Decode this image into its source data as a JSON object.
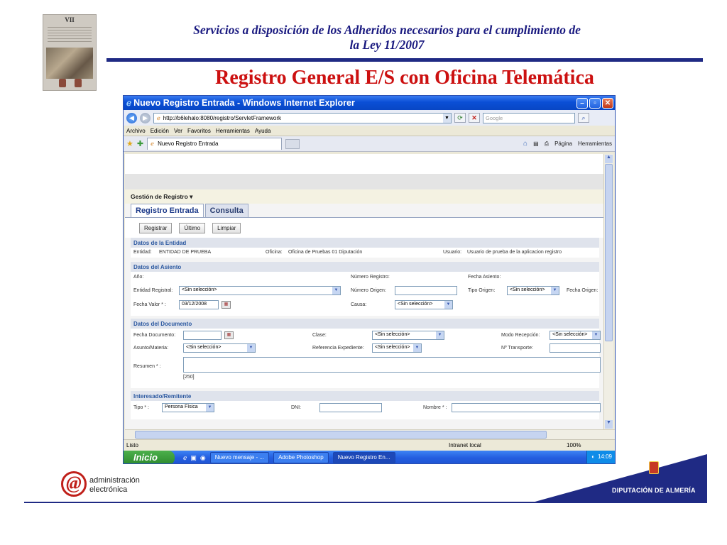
{
  "slide": {
    "header_line1": "Servicios a disposición de los Adheridos necesarios para el cumplimiento de",
    "header_line2": "la Ley 11/2007",
    "title": "Registro General E/S con Oficina Telemática",
    "thumbnail_title": "VII"
  },
  "browser": {
    "window_title": "Nuevo Registro Entrada - Windows Internet Explorer",
    "url": "http://b6lehalo:8080/registro/ServletFramework",
    "search_placeholder": "Google",
    "menu": [
      "Archivo",
      "Edición",
      "Ver",
      "Favoritos",
      "Herramientas",
      "Ayuda"
    ],
    "tab_label": "Nuevo Registro Entrada",
    "cmd_pagina": "Página",
    "cmd_herramientas": "Herramientas",
    "status_text": "Listo",
    "status_zone": "Intranet local",
    "status_zoom": "100%"
  },
  "app": {
    "gestion_menu": "Gestión de Registro ▾",
    "tabs": [
      "Registro Entrada",
      "Consulta"
    ],
    "buttons": [
      "Registrar",
      "Último",
      "Limpiar"
    ],
    "entidad": {
      "header": "Datos de la Entidad",
      "entidad_label": "Entidad:",
      "entidad_value": "ENTIDAD DE PRUEBA",
      "oficina_label": "Oficina:",
      "oficina_value": "Oficina de Pruebas 01 Diputación",
      "usuario_label": "Usuario:",
      "usuario_value": "Usuario de prueba de la aplicacion registro"
    },
    "asiento": {
      "header": "Datos del Asiento",
      "anio_label": "Año:",
      "numero_registro_label": "Número Registro:",
      "fecha_asiento_label": "Fecha Asiento:",
      "entidad_registral_label": "Entidad Registral:",
      "entidad_registral_value": "<Sin selección>",
      "numero_origen_label": "Número Origen:",
      "tipo_origen_label": "Tipo Origen:",
      "tipo_origen_value": "<Sin selección>",
      "fecha_origen_label": "Fecha Origen:",
      "fecha_valor_label": "Fecha Valor * :",
      "fecha_valor_value": "03/12/2008",
      "causa_label": "Causa:",
      "causa_value": "<Sin selección>"
    },
    "documento": {
      "header": "Datos del Documento",
      "fecha_documento_label": "Fecha Documento:",
      "clase_label": "Clase:",
      "clase_value": "<Sin selección>",
      "modo_recepcion_label": "Modo Recepción:",
      "modo_recepcion_value": "<Sin selección>",
      "asunto_label": "Asunto/Materia:",
      "asunto_value": "<Sin selección>",
      "referencia_label": "Referencia Expediente:",
      "referencia_value": "<Sin selección>",
      "transporte_label": "Nº Transporte:",
      "resumen_label": "Resumen * :",
      "resumen_counter": "[250]"
    },
    "interesado": {
      "header": "Interesado/Remitente",
      "tipo_label": "Tipo * :",
      "tipo_value": "Persona Física",
      "dni_label": "DNI:",
      "nombre_label": "Nombre * :"
    }
  },
  "taskbar": {
    "start_label": "Inicio",
    "tasks": [
      "Nuevo mensaje - ...",
      "Adobe Photoshop",
      "Nuevo Registro En..."
    ],
    "clock": "14:09"
  },
  "footer": {
    "logo_line1": "administración",
    "logo_line2": "electrónica",
    "diputacion": "DIPUTACIÓN DE ALMERÍA"
  }
}
